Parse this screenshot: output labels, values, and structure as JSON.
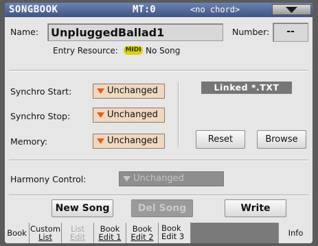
{
  "titlebar": {
    "title": "SONGBOOK",
    "mt": "MT:0",
    "chord": "<no chord>",
    "menu_icon": "chevron-down-icon"
  },
  "entry": {
    "name_label": "Name:",
    "name_value": "UnpluggedBallad1",
    "number_label": "Number:",
    "number_value": "--",
    "resource_label": "Entry Resource:",
    "resource_badge": "MIDI",
    "resource_value": "No Song"
  },
  "synchro": {
    "start_label": "Synchro Start:",
    "start_value": "Unchanged",
    "stop_label": "Synchro Stop:",
    "stop_value": "Unchanged",
    "memory_label": "Memory:",
    "memory_value": "Unchanged"
  },
  "linked": {
    "label": "Linked *.TXT",
    "reset": "Reset",
    "browse": "Browse"
  },
  "harmony": {
    "label": "Harmony Control:",
    "value": "Unchanged"
  },
  "actions": {
    "new_song": "New Song",
    "del_song": "Del Song",
    "write": "Write"
  },
  "tabs": [
    {
      "line1": "Book",
      "line2": ""
    },
    {
      "line1": "Custom",
      "line2": "List"
    },
    {
      "line1": "List",
      "line2": "Edit"
    },
    {
      "line1": "Book",
      "line2": "Edit 1"
    },
    {
      "line1": "Book",
      "line2": "Edit 2"
    },
    {
      "line1": "Book",
      "line2": "Edit 3"
    },
    {
      "line1": "Info",
      "line2": ""
    }
  ],
  "colors": {
    "titlebar": "#4a5f8e",
    "dropdown": "#f0d7bf",
    "midi_badge": "#d7d200"
  }
}
